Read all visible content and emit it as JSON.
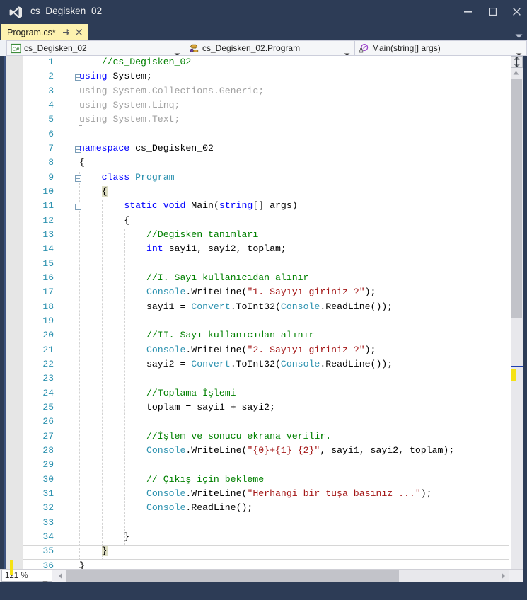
{
  "window": {
    "title": "cs_Degisken_02",
    "logo_icon": "visual-studio-logo",
    "minimize_label": "Minimize",
    "maximize_label": "Maximize",
    "close_label": "Close"
  },
  "tabs": {
    "active": {
      "label": "Program.cs*",
      "pin_icon": "pin-icon",
      "close_icon": "close-icon"
    },
    "overflow_icon": "chevron-down-icon"
  },
  "navbar": {
    "project": {
      "icon": "csharp-project-icon",
      "value": "cs_Degisken_02",
      "arrow_icon": "chevron-down-icon"
    },
    "type": {
      "icon": "class-icon",
      "value": "cs_Degisken_02.Program",
      "arrow_icon": "chevron-down-icon"
    },
    "member": {
      "icon": "method-private-icon",
      "value": "Main(string[] args)",
      "arrow_icon": "chevron-down-icon"
    }
  },
  "editor": {
    "zoom_level": "121 %",
    "zoom_arrow_icon": "chevron-down-icon",
    "split_icon": "split-view-icon",
    "scroll_up_icon": "scroll-up-arrow-icon",
    "scroll_left_icon": "scroll-left-arrow-icon",
    "scroll_right_icon": "scroll-right-arrow-icon",
    "current_line": 35,
    "changed_lines": [
      36
    ],
    "colors": {
      "comment": "#008000",
      "keyword": "#0000FF",
      "type": "#2B91AF",
      "string": "#A31515",
      "plain": "#000000",
      "unused_using": "#A0A0A0",
      "line_number": "#2B91AF",
      "chrome": "#2D3C56",
      "active_tab": "#FDF2AF",
      "change_bar": "#F5E214",
      "brace_match": "#DEDEC4"
    },
    "lines": [
      {
        "n": 1,
        "tokens": [
          {
            "t": "    ",
            "c": "plain"
          },
          {
            "t": "//cs_Degisken_02",
            "c": "cmt"
          }
        ]
      },
      {
        "n": 2,
        "tokens": [
          {
            "t": "using",
            "c": "kw"
          },
          {
            "t": " System;",
            "c": "plain"
          }
        ]
      },
      {
        "n": 3,
        "tokens": [
          {
            "t": "using System.Collections.Generic;",
            "c": "gray"
          }
        ]
      },
      {
        "n": 4,
        "tokens": [
          {
            "t": "using System.Linq;",
            "c": "gray"
          }
        ]
      },
      {
        "n": 5,
        "tokens": [
          {
            "t": "using System.Text;",
            "c": "gray"
          }
        ]
      },
      {
        "n": 6,
        "tokens": []
      },
      {
        "n": 7,
        "tokens": [
          {
            "t": "namespace",
            "c": "kw"
          },
          {
            "t": " cs_Degisken_02",
            "c": "plain"
          }
        ]
      },
      {
        "n": 8,
        "tokens": [
          {
            "t": "{",
            "c": "plain"
          }
        ]
      },
      {
        "n": 9,
        "tokens": [
          {
            "t": "    ",
            "c": "plain"
          },
          {
            "t": "class",
            "c": "kw"
          },
          {
            "t": " ",
            "c": "plain"
          },
          {
            "t": "Program",
            "c": "typ"
          }
        ]
      },
      {
        "n": 10,
        "tokens": [
          {
            "t": "    ",
            "c": "plain"
          },
          {
            "t": "{",
            "c": "brmatch"
          }
        ]
      },
      {
        "n": 11,
        "tokens": [
          {
            "t": "        ",
            "c": "plain"
          },
          {
            "t": "static",
            "c": "kw"
          },
          {
            "t": " ",
            "c": "plain"
          },
          {
            "t": "void",
            "c": "kw"
          },
          {
            "t": " Main(",
            "c": "plain"
          },
          {
            "t": "string",
            "c": "kw"
          },
          {
            "t": "[] args)",
            "c": "plain"
          }
        ]
      },
      {
        "n": 12,
        "tokens": [
          {
            "t": "        {",
            "c": "plain"
          }
        ]
      },
      {
        "n": 13,
        "tokens": [
          {
            "t": "            ",
            "c": "plain"
          },
          {
            "t": "//Degisken tanımları",
            "c": "cmt"
          }
        ]
      },
      {
        "n": 14,
        "tokens": [
          {
            "t": "            ",
            "c": "plain"
          },
          {
            "t": "int",
            "c": "kw"
          },
          {
            "t": " sayi1, sayi2, toplam;",
            "c": "plain"
          }
        ]
      },
      {
        "n": 15,
        "tokens": []
      },
      {
        "n": 16,
        "tokens": [
          {
            "t": "            ",
            "c": "plain"
          },
          {
            "t": "//I. Sayı kullanıcıdan alınır",
            "c": "cmt"
          }
        ]
      },
      {
        "n": 17,
        "tokens": [
          {
            "t": "            ",
            "c": "plain"
          },
          {
            "t": "Console",
            "c": "typ"
          },
          {
            "t": ".WriteLine(",
            "c": "plain"
          },
          {
            "t": "\"1. Sayıyı giriniz ?\"",
            "c": "str"
          },
          {
            "t": ");",
            "c": "plain"
          }
        ]
      },
      {
        "n": 18,
        "tokens": [
          {
            "t": "            sayi1 = ",
            "c": "plain"
          },
          {
            "t": "Convert",
            "c": "typ"
          },
          {
            "t": ".ToInt32(",
            "c": "plain"
          },
          {
            "t": "Console",
            "c": "typ"
          },
          {
            "t": ".ReadLine());",
            "c": "plain"
          }
        ]
      },
      {
        "n": 19,
        "tokens": []
      },
      {
        "n": 20,
        "tokens": [
          {
            "t": "            ",
            "c": "plain"
          },
          {
            "t": "//II. Sayı kullanıcıdan alınır",
            "c": "cmt"
          }
        ]
      },
      {
        "n": 21,
        "tokens": [
          {
            "t": "            ",
            "c": "plain"
          },
          {
            "t": "Console",
            "c": "typ"
          },
          {
            "t": ".WriteLine(",
            "c": "plain"
          },
          {
            "t": "\"2. Sayıyı giriniz ?\"",
            "c": "str"
          },
          {
            "t": ");",
            "c": "plain"
          }
        ]
      },
      {
        "n": 22,
        "tokens": [
          {
            "t": "            sayi2 = ",
            "c": "plain"
          },
          {
            "t": "Convert",
            "c": "typ"
          },
          {
            "t": ".ToInt32(",
            "c": "plain"
          },
          {
            "t": "Console",
            "c": "typ"
          },
          {
            "t": ".ReadLine());",
            "c": "plain"
          }
        ]
      },
      {
        "n": 23,
        "tokens": []
      },
      {
        "n": 24,
        "tokens": [
          {
            "t": "            ",
            "c": "plain"
          },
          {
            "t": "//Toplama İşlemi",
            "c": "cmt"
          }
        ]
      },
      {
        "n": 25,
        "tokens": [
          {
            "t": "            toplam = sayi1 + sayi2;",
            "c": "plain"
          }
        ]
      },
      {
        "n": 26,
        "tokens": []
      },
      {
        "n": 27,
        "tokens": [
          {
            "t": "            ",
            "c": "plain"
          },
          {
            "t": "//İşlem ve sonucu ekrana verilir.",
            "c": "cmt"
          }
        ]
      },
      {
        "n": 28,
        "tokens": [
          {
            "t": "            ",
            "c": "plain"
          },
          {
            "t": "Console",
            "c": "typ"
          },
          {
            "t": ".WriteLine(",
            "c": "plain"
          },
          {
            "t": "\"{0}+{1}={2}\"",
            "c": "str"
          },
          {
            "t": ", sayi1, sayi2, toplam);",
            "c": "plain"
          }
        ]
      },
      {
        "n": 29,
        "tokens": []
      },
      {
        "n": 30,
        "tokens": [
          {
            "t": "            ",
            "c": "plain"
          },
          {
            "t": "// Çıkış için bekleme",
            "c": "cmt"
          }
        ]
      },
      {
        "n": 31,
        "tokens": [
          {
            "t": "            ",
            "c": "plain"
          },
          {
            "t": "Console",
            "c": "typ"
          },
          {
            "t": ".WriteLine(",
            "c": "plain"
          },
          {
            "t": "\"Herhangi bir tuşa basınız ...\"",
            "c": "str"
          },
          {
            "t": ");",
            "c": "plain"
          }
        ]
      },
      {
        "n": 32,
        "tokens": [
          {
            "t": "            ",
            "c": "plain"
          },
          {
            "t": "Console",
            "c": "typ"
          },
          {
            "t": ".ReadLine();",
            "c": "plain"
          }
        ]
      },
      {
        "n": 33,
        "tokens": []
      },
      {
        "n": 34,
        "tokens": [
          {
            "t": "        }",
            "c": "plain"
          }
        ]
      },
      {
        "n": 35,
        "tokens": [
          {
            "t": "    ",
            "c": "plain"
          },
          {
            "t": "}",
            "c": "brmatch"
          }
        ]
      },
      {
        "n": 36,
        "tokens": [
          {
            "t": "}",
            "c": "plain"
          }
        ]
      }
    ]
  }
}
